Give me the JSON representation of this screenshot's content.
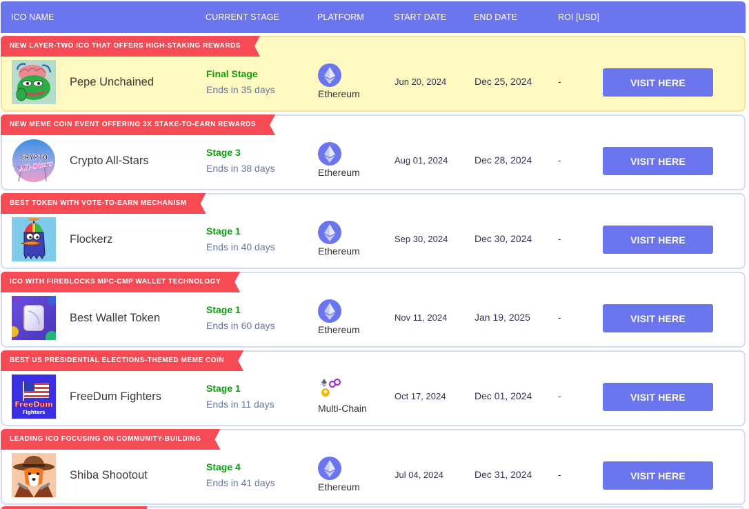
{
  "header": {
    "ico_name": "ICO NAME",
    "current_stage": "CURRENT STAGE",
    "platform": "PLATFORM",
    "start_date": "START DATE",
    "end_date": "END DATE",
    "roi": "ROI [USD]"
  },
  "colors": {
    "accent": "#6a75ee",
    "ribbon": "#f64a55",
    "stage_green": "#0aa00a",
    "featured_bg": "#fef9c0"
  },
  "rows": [
    {
      "ribbon": "NEW LAYER-TWO ICO THAT OFFERS HIGH-STAKING REWARDS",
      "name": "Pepe Unchained",
      "logo": "pepe-unchained-logo",
      "stage": "Final Stage",
      "ends": "Ends in 35 days",
      "platform_icon": "ethereum-icon",
      "platform": "Ethereum",
      "start": "Jun 20, 2024",
      "end": "Dec 25, 2024",
      "roi": "-",
      "button": "VISIT HERE",
      "featured": true
    },
    {
      "ribbon": "NEW MEME COIN EVENT OFFERING 3X STAKE-TO-EARN REWARDS",
      "name": "Crypto All-Stars",
      "logo": "crypto-all-stars-logo",
      "stage": "Stage 3",
      "ends": "Ends in 38 days",
      "platform_icon": "ethereum-icon",
      "platform": "Ethereum",
      "start": "Aug 01, 2024",
      "end": "Dec 28, 2024",
      "roi": "-",
      "button": "VISIT HERE"
    },
    {
      "ribbon": "BEST TOKEN WITH VOTE-TO-EARN MECHANISM",
      "name": "Flockerz",
      "logo": "flockerz-logo",
      "stage": "Stage 1",
      "ends": "Ends in 40 days",
      "platform_icon": "ethereum-icon",
      "platform": "Ethereum",
      "start": "Sep 30, 2024",
      "end": "Dec 30, 2024",
      "roi": "-",
      "button": "VISIT HERE"
    },
    {
      "ribbon": "ICO WITH FIREBLOCKS MPC-CMP WALLET TECHNOLOGY",
      "name": "Best Wallet Token",
      "logo": "best-wallet-logo",
      "stage": "Stage 1",
      "ends": "Ends in 60 days",
      "platform_icon": "ethereum-icon",
      "platform": "Ethereum",
      "start": "Nov 11, 2024",
      "end": "Jan 19, 2025",
      "roi": "-",
      "button": "VISIT HERE"
    },
    {
      "ribbon": "BEST US PRESIDENTIAL ELECTIONS-THEMED MEME COIN",
      "name": "FreeDum Fighters",
      "logo": "freedum-fighters-logo",
      "logo_text_1": "FreeDum",
      "logo_text_2": "Fighters",
      "stage": "Stage 1",
      "ends": "Ends in 11 days",
      "platform_icon": "multi-chain-icon",
      "platform": "Multi-Chain",
      "start": "Oct 17, 2024",
      "end": "Dec 01, 2024",
      "roi": "-",
      "button": "VISIT HERE"
    },
    {
      "ribbon": "LEADING ICO FOCUSING ON COMMUNITY-BUILDING",
      "name": "Shiba Shootout",
      "logo": "shiba-shootout-logo",
      "stage": "Stage 4",
      "ends": "Ends in 41 days",
      "platform_icon": "ethereum-icon",
      "platform": "Ethereum",
      "start": "Jul 04, 2024",
      "end": "Dec 31, 2024",
      "roi": "-",
      "button": "VISIT HERE"
    }
  ],
  "crypto_logo_text_1": "CRYPTO",
  "crypto_logo_text_2": "All-Stars"
}
